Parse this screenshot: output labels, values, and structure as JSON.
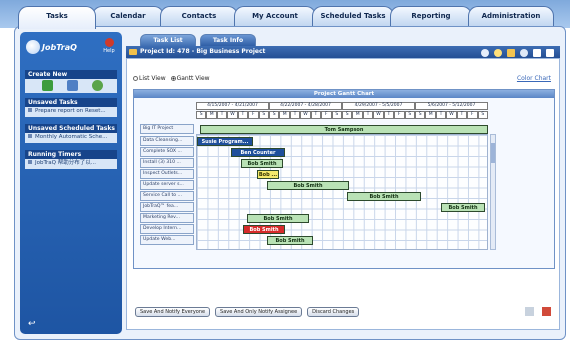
{
  "top_tabs": [
    "Tasks",
    "Calendar",
    "Contacts",
    "My Account",
    "Scheduled Tasks",
    "Reporting",
    "Administration"
  ],
  "active_top_tab": "Tasks",
  "sidebar": {
    "logo": "JobTraQ",
    "help": "Help",
    "create_new": "Create New",
    "unsaved_tasks": {
      "title": "Unsaved Tasks",
      "items": [
        "Prepare report on Reset..."
      ]
    },
    "unsaved_scheduled": {
      "title": "Unsaved Scheduled Tasks",
      "items": [
        "Monthly Automatic Sche..."
      ]
    },
    "running_timers": {
      "title": "Running Timers",
      "items": [
        "JobTraQ 帮助分布了以..."
      ]
    }
  },
  "panel_tabs": [
    "Task List",
    "Task Info"
  ],
  "active_panel_tab": "Task Info",
  "project_title": "Project Id: 478 - Big Business Project",
  "view": {
    "list_label": "List View",
    "gantt_label": "Gantt View",
    "selected": "gantt"
  },
  "color_chart_link": "Color Chart",
  "gantt": {
    "title": "Project Gantt Chart",
    "weeks": [
      "4/15/2007 - 4/21/2007",
      "4/22/2007 - 4/28/2007",
      "4/29/2007 - 5/5/2007",
      "5/6/2007 - 5/12/2007"
    ],
    "day_letters": [
      "S",
      "M",
      "T",
      "W",
      "T",
      "F",
      "S",
      "S",
      "M",
      "T",
      "W",
      "T",
      "F",
      "S",
      "S",
      "M",
      "T",
      "W",
      "T",
      "F",
      "S",
      "S",
      "M",
      "T",
      "W",
      "T",
      "F",
      "S"
    ],
    "project_row_label": "Big IT Project",
    "project_owner": "Tom Sampson",
    "rows": [
      "Data Cleansing...",
      "Complete SOX ...",
      "Install (3) 310 ...",
      "Inspect Outlets...",
      "Update server s...",
      "Service Call to ...",
      "JobTraQ™ fea...",
      "Marketing Rev...",
      "Develop Intern...",
      "Update Web..."
    ],
    "bars": [
      {
        "row": 0,
        "label": "Susie Program...",
        "color": "#1f4f9c",
        "text_color": "#ffffff"
      },
      {
        "row": 1,
        "label": "Ben Counter",
        "color": "#1f4f9c",
        "text_color": "#ffffff"
      },
      {
        "row": 2,
        "label": "Bob Smith",
        "color": "#b9e2b5",
        "text_color": "#123012"
      },
      {
        "row": 3,
        "label": "Bob ...",
        "color": "#f4ea6c",
        "text_color": "#333300"
      },
      {
        "row": 4,
        "label": "Bob Smith",
        "color": "#b9e2b5",
        "text_color": "#123012"
      },
      {
        "row": 5,
        "label": "Bob Smith",
        "color": "#b9e2b5",
        "text_color": "#123012"
      },
      {
        "row": 6,
        "label": "Bob Smith",
        "color": "#b9e2b5",
        "text_color": "#123012"
      },
      {
        "row": 7,
        "label": "Bob Smith",
        "color": "#b9e2b5",
        "text_color": "#123012"
      },
      {
        "row": 8,
        "label": "Bob Smith",
        "color": "#d62b2b",
        "text_color": "#ffffff"
      },
      {
        "row": 9,
        "label": "Bob Smith",
        "color": "#b9e2b5",
        "text_color": "#123012"
      }
    ]
  },
  "actions": [
    "Save And Notify Everyone",
    "Save And Only Notify Assignee",
    "Discard Changes"
  ]
}
